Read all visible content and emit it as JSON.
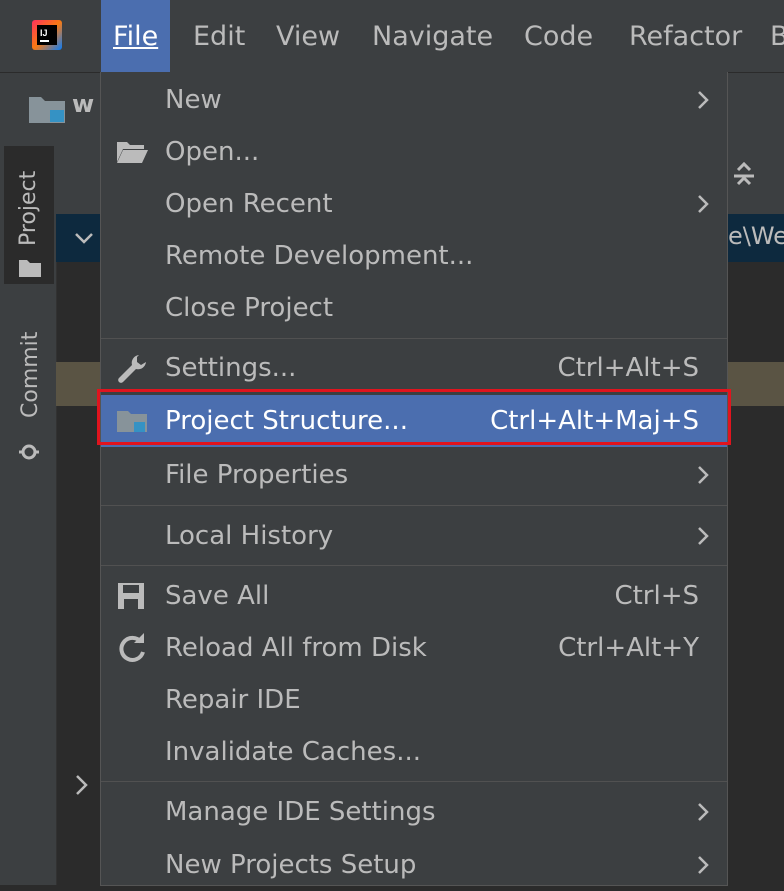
{
  "menubar": {
    "items": [
      "File",
      "Edit",
      "View",
      "Navigate",
      "Code",
      "Refactor",
      "B"
    ]
  },
  "toolbar": {
    "project_name": "w"
  },
  "background": {
    "path_fragment": "e\\We"
  },
  "side_tabs": {
    "project": "Project",
    "commit": "Commit"
  },
  "file_menu": {
    "items": [
      {
        "label": "New",
        "submenu": true
      },
      {
        "label": "Open...",
        "icon": "folder-open-icon"
      },
      {
        "label": "Open Recent",
        "submenu": true
      },
      {
        "label": "Remote Development..."
      },
      {
        "label": "Close Project"
      },
      {
        "label": "Settings...",
        "shortcut": "Ctrl+Alt+S",
        "icon": "wrench-icon"
      },
      {
        "label": "Project Structure...",
        "shortcut": "Ctrl+Alt+Maj+S",
        "icon": "project-structure-icon",
        "selected": true
      },
      {
        "label": "File Properties",
        "submenu": true
      },
      {
        "label": "Local History",
        "submenu": true
      },
      {
        "label": "Save All",
        "shortcut": "Ctrl+S",
        "icon": "save-icon"
      },
      {
        "label": "Reload All from Disk",
        "shortcut": "Ctrl+Alt+Y",
        "icon": "reload-icon"
      },
      {
        "label": "Repair IDE"
      },
      {
        "label": "Invalidate Caches..."
      },
      {
        "label": "Manage IDE Settings",
        "submenu": true
      },
      {
        "label": "New Projects Setup",
        "submenu": true
      }
    ]
  },
  "colors": {
    "menu_bg": "#3c3f41",
    "selection": "#4b6eaf",
    "highlight_border": "#e0141e"
  }
}
